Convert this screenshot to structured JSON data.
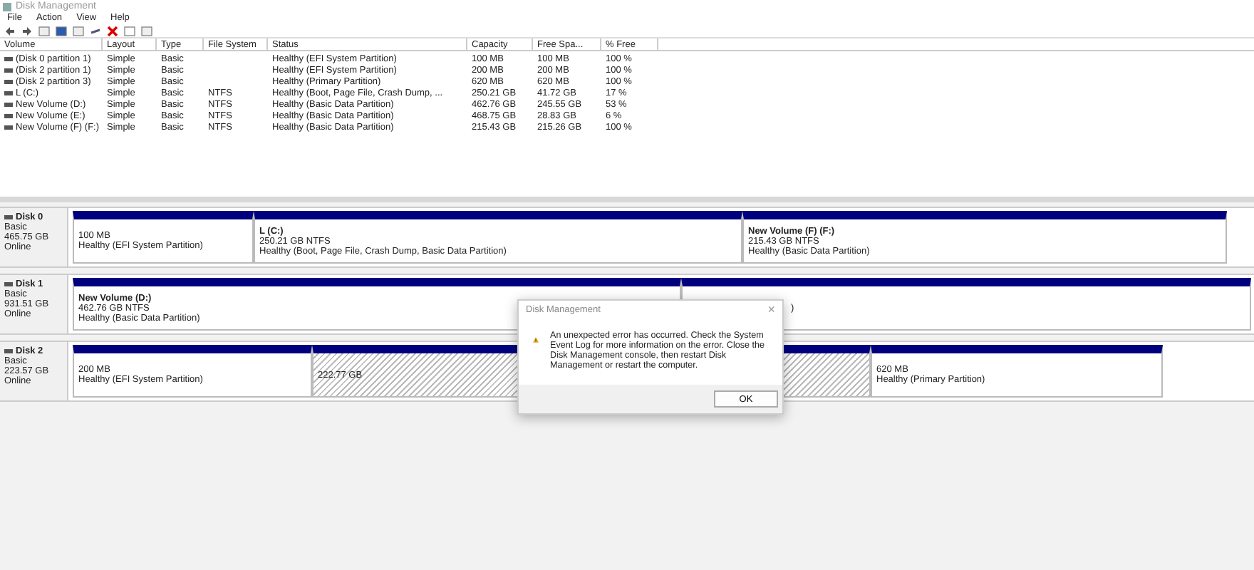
{
  "window": {
    "title": "Disk Management"
  },
  "menu": [
    "File",
    "Action",
    "View",
    "Help"
  ],
  "table": {
    "columns": [
      "Volume",
      "Layout",
      "Type",
      "File System",
      "Status",
      "Capacity",
      "Free Spa...",
      "% Free"
    ],
    "rows": [
      [
        "(Disk 0 partition 1)",
        "Simple",
        "Basic",
        "",
        "Healthy (EFI System Partition)",
        "100 MB",
        "100 MB",
        "100 %"
      ],
      [
        "(Disk 2 partition 1)",
        "Simple",
        "Basic",
        "",
        "Healthy (EFI System Partition)",
        "200 MB",
        "200 MB",
        "100 %"
      ],
      [
        "(Disk 2 partition 3)",
        "Simple",
        "Basic",
        "",
        "Healthy (Primary Partition)",
        "620 MB",
        "620 MB",
        "100 %"
      ],
      [
        "L (C:)",
        "Simple",
        "Basic",
        "NTFS",
        "Healthy (Boot, Page File, Crash Dump, ...",
        "250.21 GB",
        "41.72 GB",
        "17 %"
      ],
      [
        "New Volume (D:)",
        "Simple",
        "Basic",
        "NTFS",
        "Healthy (Basic Data Partition)",
        "462.76 GB",
        "245.55 GB",
        "53 %"
      ],
      [
        "New Volume (E:)",
        "Simple",
        "Basic",
        "NTFS",
        "Healthy (Basic Data Partition)",
        "468.75 GB",
        "28.83 GB",
        "6 %"
      ],
      [
        "New Volume (F) (F:)",
        "Simple",
        "Basic",
        "NTFS",
        "Healthy (Basic Data Partition)",
        "215.43 GB",
        "215.26 GB",
        "100 %"
      ]
    ]
  },
  "disks": [
    {
      "name": "Disk 0",
      "type": "Basic",
      "size": "465.75 GB",
      "state": "Online",
      "partitions": [
        {
          "kind": "primary",
          "lines": [
            "100 MB",
            "Healthy (EFI System Partition)"
          ]
        },
        {
          "kind": "primary",
          "name": "L  (C:)",
          "lines": [
            "250.21 GB NTFS",
            "Healthy (Boot, Page File, Crash Dump, Basic Data Partition)"
          ]
        },
        {
          "kind": "primary",
          "name": "New Volume (F)  (F:)",
          "lines": [
            "215.43 GB NTFS",
            "Healthy (Basic Data Partition)"
          ]
        }
      ]
    },
    {
      "name": "Disk 1",
      "type": "Basic",
      "size": "931.51 GB",
      "state": "Online",
      "partitions": [
        {
          "kind": "primary",
          "name": "New Volume  (D:)",
          "lines": [
            "462.76 GB NTFS",
            "Healthy (Basic Data Partition)"
          ]
        },
        {
          "kind": "covered",
          "lines": [
            ")"
          ]
        }
      ]
    },
    {
      "name": "Disk 2",
      "type": "Basic",
      "size": "223.57 GB",
      "state": "Online",
      "partitions": [
        {
          "kind": "primary",
          "lines": [
            "200 MB",
            "Healthy (EFI System Partition)"
          ]
        },
        {
          "kind": "unallocated",
          "lines": [
            "222.77 GB"
          ]
        },
        {
          "kind": "primary",
          "lines": [
            "620 MB",
            "Healthy (Primary Partition)"
          ]
        }
      ]
    }
  ],
  "dialog": {
    "title": "Disk Management",
    "message": "An unexpected error has occurred. Check the System Event Log for more information on the error. Close the Disk Management console, then restart Disk Management or restart the computer.",
    "close": "×",
    "button": "OK"
  }
}
